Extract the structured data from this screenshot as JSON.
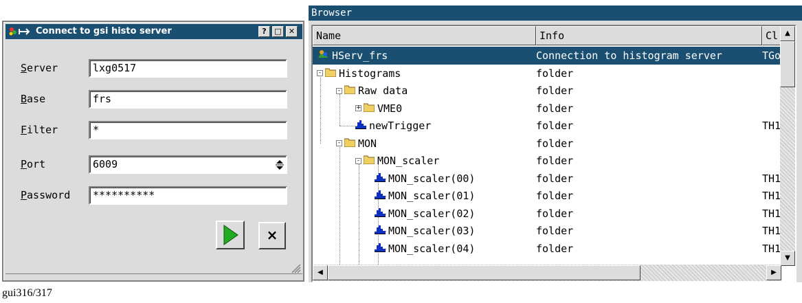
{
  "dialog": {
    "title": "Connect to gsi histo server",
    "title_buttons": [
      "?",
      "□",
      "✕"
    ],
    "fields": [
      {
        "label_ul": "S",
        "label_rest": "erver",
        "value": "lxg0517"
      },
      {
        "label_ul": "B",
        "label_rest": "ase",
        "value": "frs"
      },
      {
        "label_ul": "F",
        "label_rest": "ilter",
        "value": "*"
      },
      {
        "label_ul": "P",
        "label_rest": "ort",
        "value": "6009"
      },
      {
        "label_ul": "P",
        "label_rest": "assword",
        "value": "**********"
      }
    ],
    "close_label": "×"
  },
  "browser": {
    "title": "Browser",
    "columns": [
      "Name",
      "Info",
      "Cl"
    ],
    "rows": [
      {
        "name": "HServ_frs",
        "info": "Connection to histogram server",
        "cls": "TGo",
        "icon": "server-icon",
        "selected": true
      },
      {
        "name": "Histograms",
        "info": "folder",
        "cls": "",
        "icon": "folder-icon",
        "expander": "-"
      },
      {
        "name": "Raw data",
        "info": "folder",
        "cls": "",
        "icon": "folder-icon",
        "expander": "-"
      },
      {
        "name": "VME0",
        "info": "folder",
        "cls": "",
        "icon": "folder-icon",
        "expander": "+"
      },
      {
        "name": "newTrigger",
        "info": "folder",
        "cls": "TH1",
        "icon": "histogram-icon"
      },
      {
        "name": "MON",
        "info": "folder",
        "cls": "",
        "icon": "folder-icon",
        "expander": "-"
      },
      {
        "name": "MON_scaler",
        "info": "folder",
        "cls": "",
        "icon": "folder-icon",
        "expander": "-"
      },
      {
        "name": "MON_scaler(00)",
        "info": "folder",
        "cls": "TH1",
        "icon": "histogram-icon"
      },
      {
        "name": "MON_scaler(01)",
        "info": "folder",
        "cls": "TH1",
        "icon": "histogram-icon"
      },
      {
        "name": "MON_scaler(02)",
        "info": "folder",
        "cls": "TH1",
        "icon": "histogram-icon"
      },
      {
        "name": "MON_scaler(03)",
        "info": "folder",
        "cls": "TH1",
        "icon": "histogram-icon"
      },
      {
        "name": "MON_scaler(04)",
        "info": "folder",
        "cls": "TH1",
        "icon": "histogram-icon"
      }
    ]
  },
  "caption": "gui316/317",
  "colors": {
    "titlebar": "#1b4f72",
    "selection": "#1b4f72",
    "chrome": "#dcdcdc",
    "play_green": "#22aa22"
  }
}
